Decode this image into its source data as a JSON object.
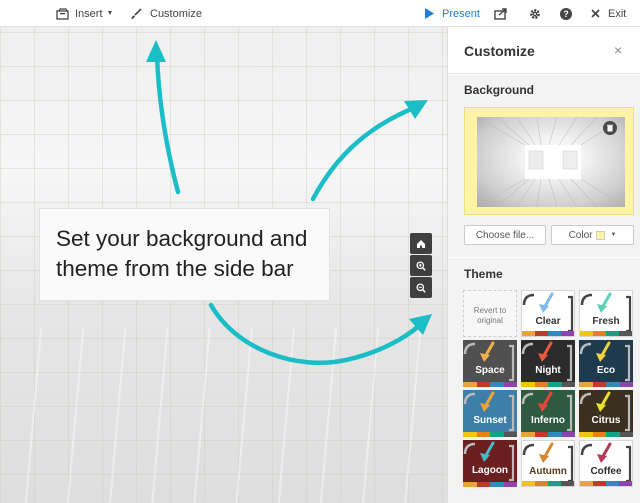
{
  "toolbar": {
    "insert_label": "Insert",
    "customize_label": "Customize",
    "present_label": "Present",
    "exit_label": "Exit"
  },
  "canvas": {
    "message": "Set your background and theme from the side bar"
  },
  "sidebar": {
    "title": "Customize",
    "close_glyph": "×",
    "background": {
      "title": "Background",
      "choose_file_label": "Choose file...",
      "color_label": "Color",
      "color_value": "#fff3a6"
    },
    "theme": {
      "title": "Theme",
      "revert_label": "Revert to original",
      "tiles": [
        {
          "name": "Clear",
          "bg": "#ffffff",
          "fg": "#333333",
          "arrow": "#7fb9e6"
        },
        {
          "name": "Fresh",
          "bg": "#ffffff",
          "fg": "#333333",
          "arrow": "#5bd1b8"
        },
        {
          "name": "Space",
          "bg": "#505050",
          "fg": "#ffffff",
          "arrow": "#f0b04a"
        },
        {
          "name": "Night",
          "bg": "#2b2b2b",
          "fg": "#ffffff",
          "arrow": "#e75a3b"
        },
        {
          "name": "Eco",
          "bg": "#1f3a4d",
          "fg": "#ffffff",
          "arrow": "#f1d23a"
        },
        {
          "name": "Sunset",
          "bg": "#3d7fa8",
          "fg": "#ffffff",
          "arrow": "#f0a23a"
        },
        {
          "name": "Inferno",
          "bg": "#2e5a3f",
          "fg": "#ffffff",
          "arrow": "#e8453a"
        },
        {
          "name": "Citrus",
          "bg": "#3b2f1e",
          "fg": "#ffffff",
          "arrow": "#e7e02c"
        },
        {
          "name": "Lagoon",
          "bg": "#6b1f1f",
          "fg": "#ffffff",
          "arrow": "#45b9c4"
        },
        {
          "name": "Autumn",
          "bg": "#ffffff",
          "fg": "#5a3a1a",
          "arrow": "#d4882f"
        },
        {
          "name": "Coffee",
          "bg": "#ffffff",
          "fg": "#2d2d2d",
          "arrow": "#b23b5a"
        }
      ]
    }
  },
  "colors": {
    "accent_teal": "#1bbec6",
    "present_blue": "#1e7fd6",
    "background_yellow": "#fff3a6"
  }
}
